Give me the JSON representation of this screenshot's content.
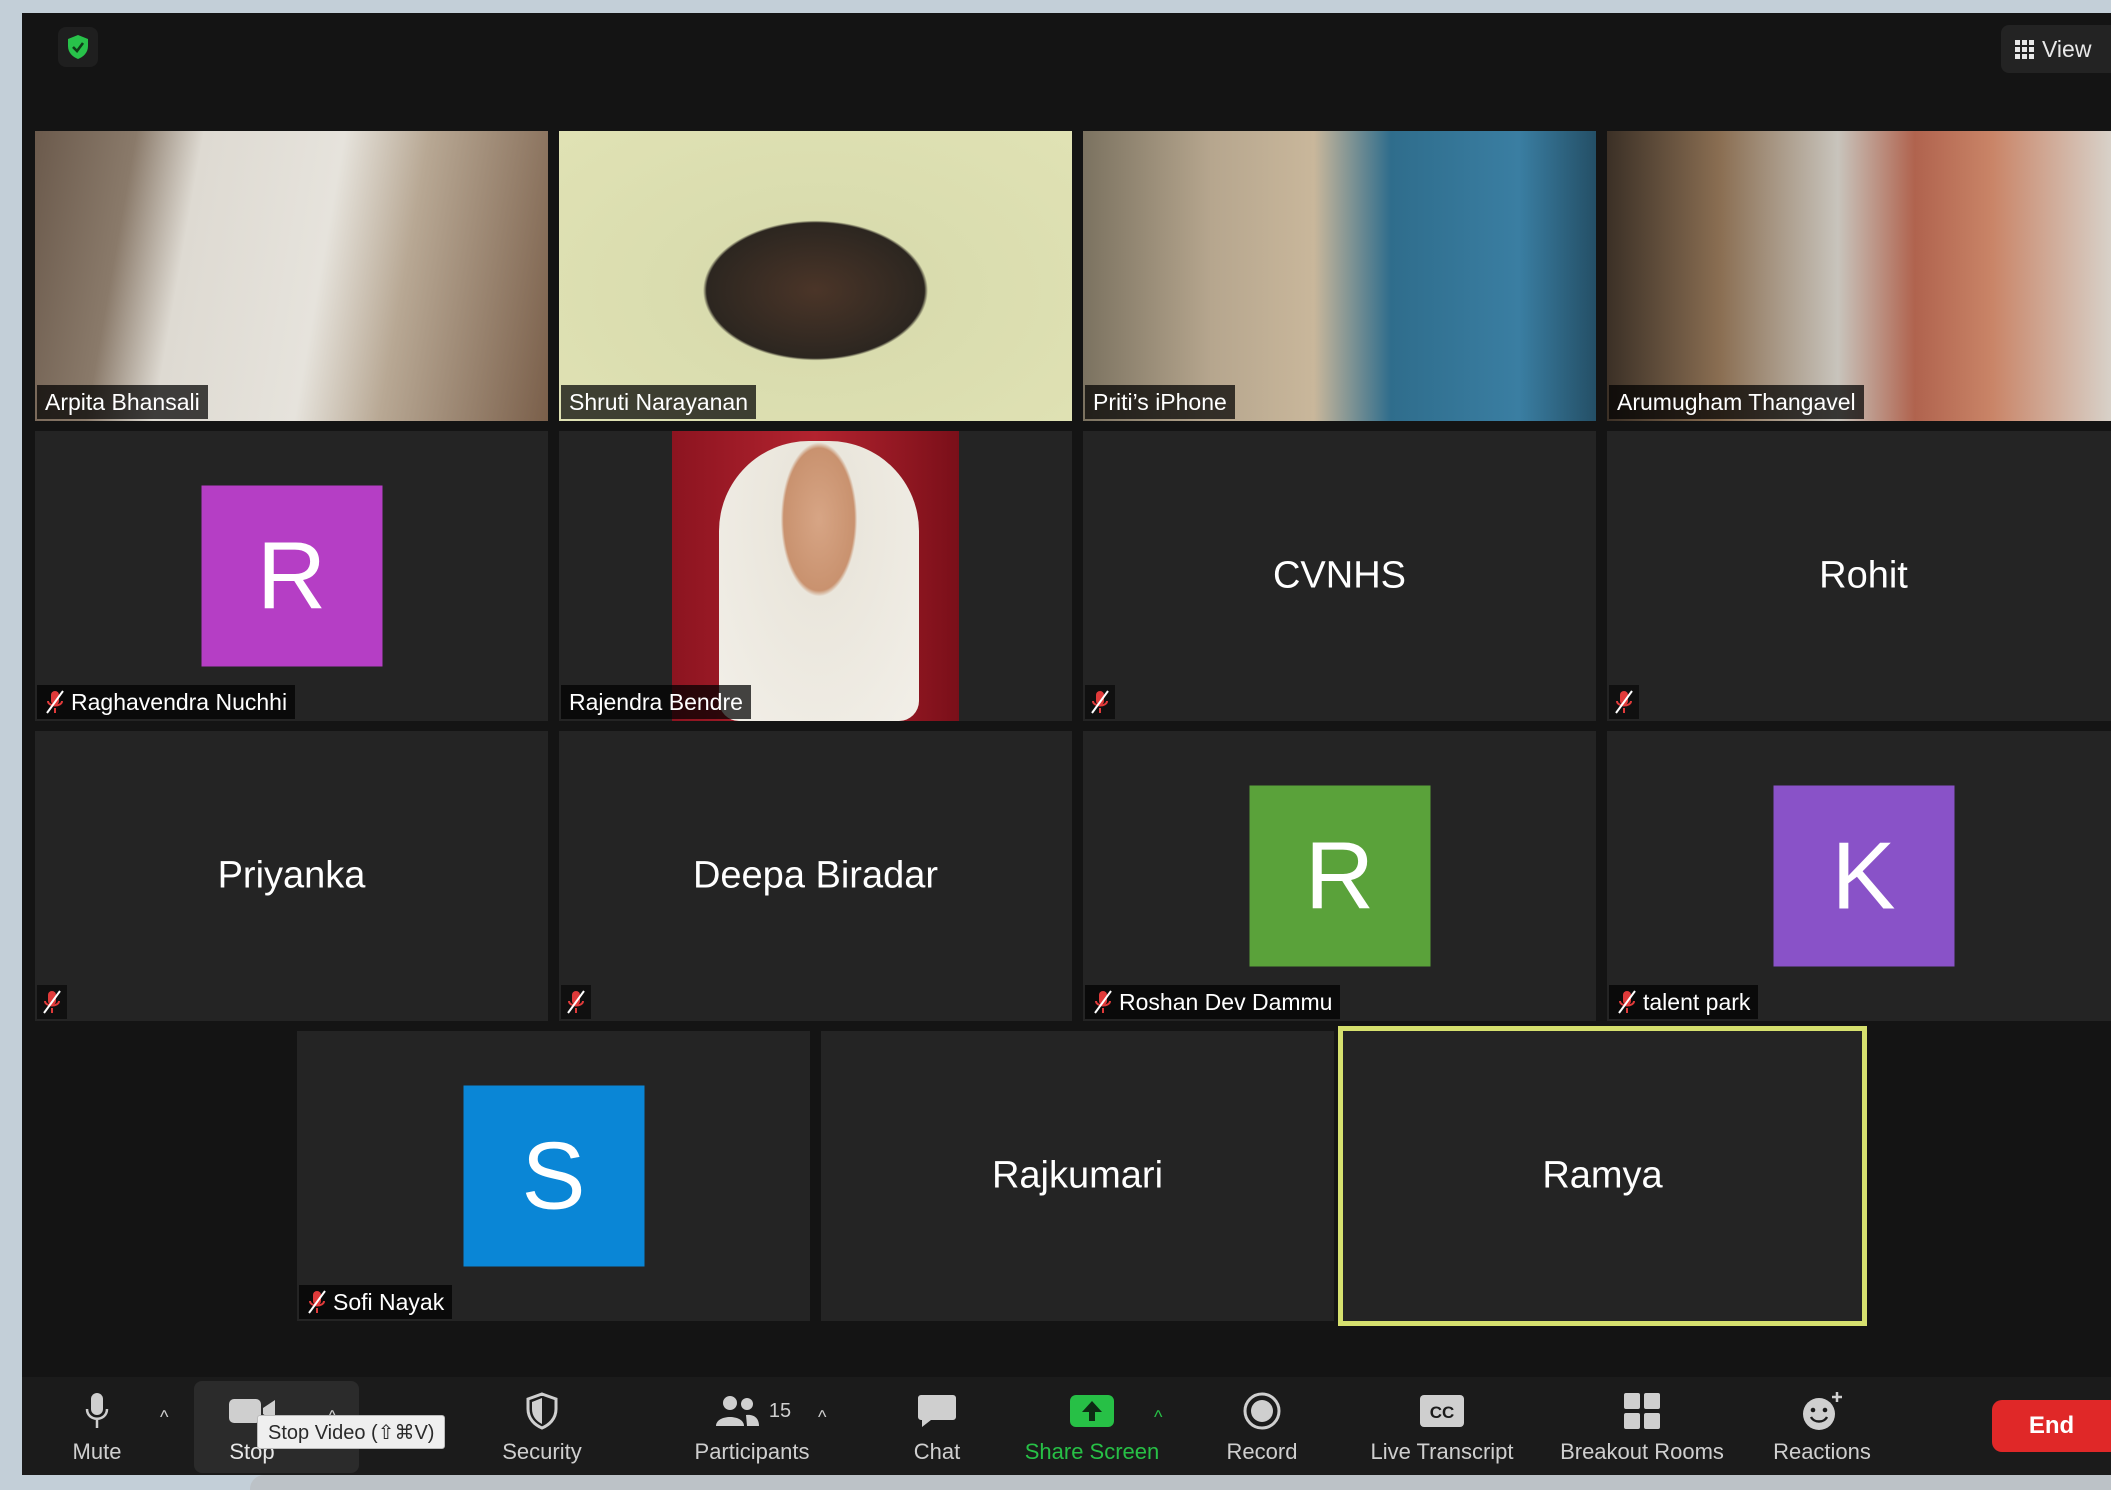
{
  "top": {
    "view_label": "View"
  },
  "tiles": {
    "arpita": "Arpita Bhansali",
    "shruti": "Shruti Narayanan",
    "priti": "Priti’s iPhone",
    "arumugham": "Arumugham Thangavel",
    "raghavendra": {
      "name": "Raghavendra Nuchhi",
      "initial": "R",
      "color": "#b53ec5"
    },
    "rajendra": "Rajendra Bendre",
    "cvnhs": "CVNHS",
    "rohit": "Rohit",
    "priyanka": "Priyanka",
    "deepa": "Deepa Biradar",
    "roshan": {
      "name": "Roshan Dev Dammu",
      "initial": "R",
      "color": "#5aa23a"
    },
    "talent": {
      "name": "talent park",
      "initial": "K",
      "color": "#8952c8"
    },
    "sofi": {
      "name": "Sofi Nayak",
      "initial": "S",
      "color": "#0a86d6"
    },
    "rajkumari": "Rajkumari",
    "ramya": "Ramya"
  },
  "toolbar": {
    "mute": "Mute",
    "stop_video": "Stop",
    "security": "Security",
    "participants": "Participants",
    "participants_count": "15",
    "chat": "Chat",
    "share_screen": "Share Screen",
    "record": "Record",
    "live_transcript": "Live Transcript",
    "breakout_rooms": "Breakout Rooms",
    "reactions": "Reactions",
    "end": "End",
    "tooltip": "Stop Video (⇧⌘V)",
    "share_color": "#27c046",
    "end_color": "#e02828"
  }
}
